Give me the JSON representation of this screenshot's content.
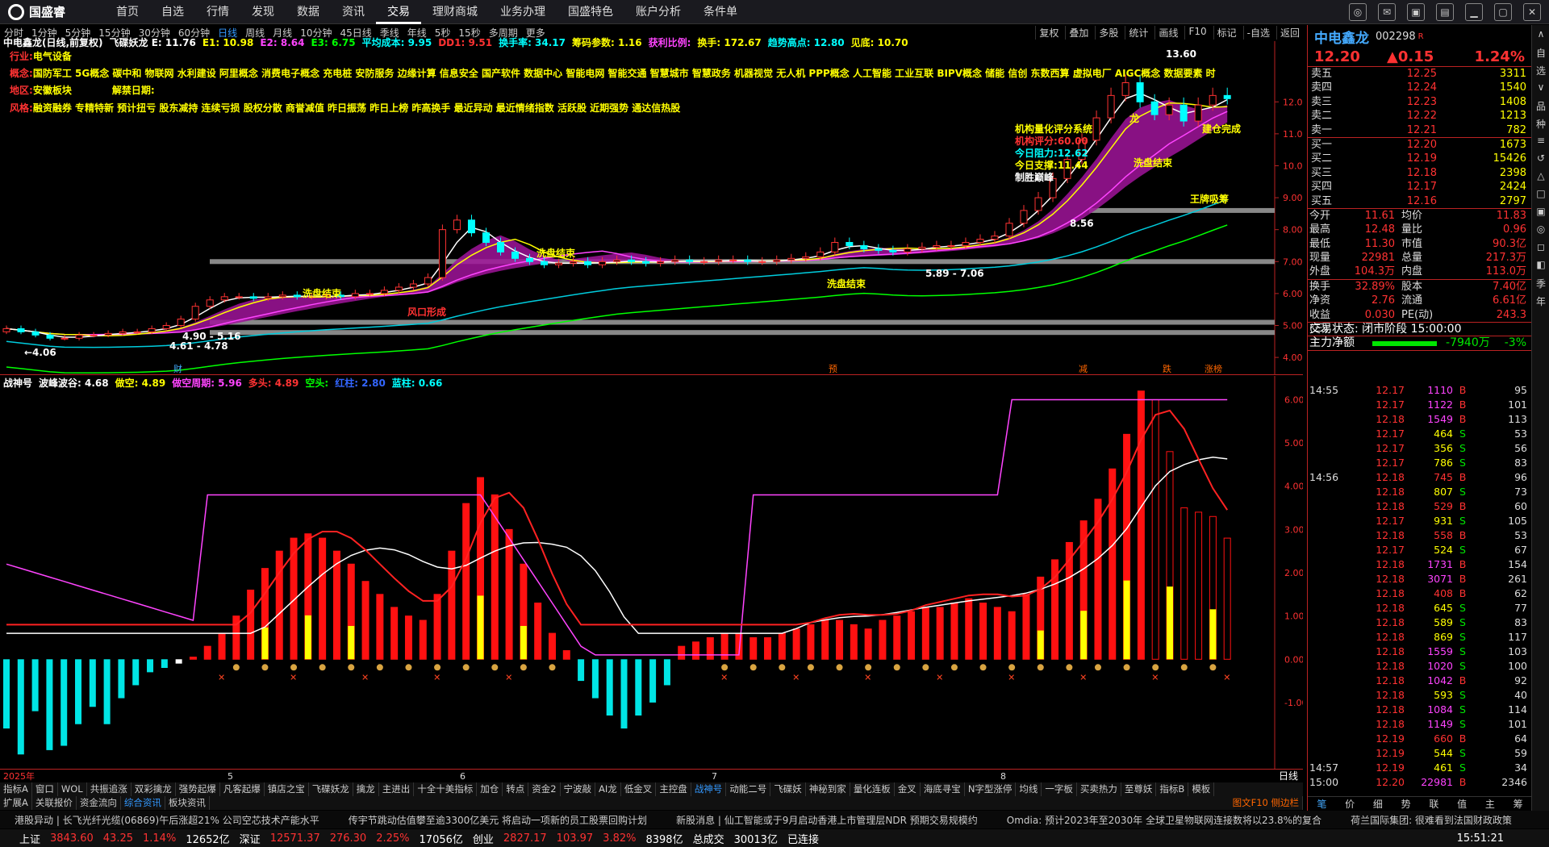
{
  "menu": {
    "logo": "国盛睿",
    "items": [
      "首页",
      "自选",
      "行情",
      "发现",
      "数据",
      "资讯",
      "交易",
      "理财商城",
      "业务办理",
      "国盛特色",
      "账户分析",
      "条件单"
    ],
    "active_index": 6
  },
  "periods": {
    "items": [
      "分时",
      "1分钟",
      "5分钟",
      "15分钟",
      "30分钟",
      "60分钟",
      "日线",
      "周线",
      "月线",
      "10分钟",
      "45日线",
      "季线",
      "年线",
      "5秒",
      "15秒",
      "多周期",
      "更多"
    ],
    "active_index": 6
  },
  "right_tools": [
    "复权",
    "叠加",
    "多股",
    "统计",
    "画线",
    "F10",
    "标记",
    "-自选",
    "返回"
  ],
  "main_header": [
    {
      "text": "中电鑫龙(日线,前复权)",
      "color": "#ffffff"
    },
    {
      "text": "飞碟妖龙 E: 11.76",
      "color": "#ffffff"
    },
    {
      "text": "E1: 10.98",
      "color": "#ffff00"
    },
    {
      "text": "E2: 8.64",
      "color": "#ff44ff"
    },
    {
      "text": "E3: 6.75",
      "color": "#00ff00"
    },
    {
      "text": "平均成本: 9.95",
      "color": "#00ffff"
    },
    {
      "text": "DD1: 9.51",
      "color": "#ff3232"
    },
    {
      "text": "换手率: 34.17",
      "color": "#00ffff"
    },
    {
      "text": "筹码参数: 1.16",
      "color": "#ffff00"
    },
    {
      "text": "获利比例:",
      "color": "#ff44ff"
    },
    {
      "text": "换手: 172.67",
      "color": "#ffff00"
    },
    {
      "text": "趋势高点: 12.80",
      "color": "#00ffff"
    },
    {
      "text": "见底: 10.70",
      "color": "#ffff00"
    }
  ],
  "info": {
    "industry_label": "行业:",
    "industry": "电气设备",
    "concept_label": "概念:",
    "concept": "国防军工 5G概念 碳中和 物联网 水利建设 阿里概念 消费电子概念 充电桩 安防服务 边缘计算 信息安全 国产软件 数据中心 智能电网 智能交通 智慧城市 智慧政务 机器视觉 无人机 PPP概念 人工智能 工业互联 BIPV概念 储能 信创 东数西算 虚拟电厂 AIGC概念 数据要素 时",
    "region_label": "地区:",
    "region": "安徽板块",
    "unlock_label": "解禁日期:",
    "style_label": "风格:",
    "style": "融资融券 专精特新 预计扭亏 股东减持 连续亏损 股权分散 商誉减值 昨日振荡 昨日上榜 昨高换手 最近异动 最近情绪指数 活跃股 近期强势 通达信热股"
  },
  "quant": {
    "title": "机构量化评分系统",
    "score_label": "机构评分:",
    "score": "60.00",
    "resist_label": "今日阻力:",
    "resist": "12.62",
    "support_label": "今日支撑:",
    "support": "11.44",
    "tag": "制胜巅峰"
  },
  "chart_data": [
    {
      "name": "main",
      "type": "candlestick",
      "ylim": [
        3.8,
        13.8
      ],
      "y_ticks": [
        "12.00",
        "11.00",
        "10.00",
        "9.00",
        "8.00",
        "7.00",
        "6.00",
        "5.00",
        "4.00"
      ],
      "annotations": [
        "13.60",
        "8.56",
        "5.89 - 7.06",
        "4.61 - 4.78",
        "4.90 - 5.16",
        "←4.06",
        "洗盘结束",
        "洗盘结束",
        "洗盘结束",
        "洗盘结束",
        "王牌吸筹",
        "建仓完成",
        "风口形成",
        "龙"
      ],
      "bottom_markers": [
        "财",
        "预",
        "减",
        "跌",
        "涨榜"
      ],
      "close_path": [
        4.9,
        4.8,
        4.7,
        4.6,
        4.6,
        4.7,
        4.7,
        4.75,
        4.8,
        4.8,
        4.9,
        5.0,
        5.2,
        5.6,
        5.8,
        5.9,
        5.9,
        5.85,
        5.9,
        5.95,
        5.9,
        5.9,
        5.95,
        5.9,
        6.0,
        6.0,
        6.1,
        6.2,
        6.3,
        6.5,
        8.0,
        8.3,
        7.9,
        7.6,
        7.3,
        7.1,
        7.0,
        6.9,
        6.95,
        7.0,
        6.9,
        7.0,
        7.05,
        7.0,
        6.95,
        7.0,
        7.05,
        7.0,
        7.0,
        7.05,
        7.05,
        7.0,
        7.0,
        7.05,
        7.1,
        7.15,
        7.3,
        7.6,
        7.5,
        7.4,
        7.35,
        7.3,
        7.4,
        7.45,
        7.5,
        7.5,
        7.6,
        7.7,
        7.8,
        8.2,
        8.6,
        9.0,
        9.6,
        10.2,
        10.8,
        11.5,
        12.2,
        12.6,
        12.0,
        11.6,
        11.9,
        11.4,
        11.9,
        12.2,
        12.1
      ]
    },
    {
      "name": "战神号",
      "type": "bar",
      "ylim": [
        -2.4,
        6.4
      ],
      "y_ticks": [
        "6.00",
        "5.00",
        "4.00",
        "3.00",
        "2.00",
        "1.00",
        "0.00",
        "-1.00"
      ],
      "header": [
        {
          "text": "战神号",
          "color": "#ffffff"
        },
        {
          "text": "波峰波谷: 4.68",
          "color": "#ffffff"
        },
        {
          "text": "做空: 4.89",
          "color": "#ffff00"
        },
        {
          "text": "做空周期: 5.96",
          "color": "#ff44ff"
        },
        {
          "text": "多头: 4.89",
          "color": "#ff3232"
        },
        {
          "text": "空头:",
          "color": "#00ff00"
        },
        {
          "text": "红柱: 2.80",
          "color": "#3366ff"
        },
        {
          "text": "蓝柱: 0.66",
          "color": "#00ffff"
        }
      ],
      "values": [
        -1.6,
        -2.2,
        -1.2,
        -2.1,
        -2.0,
        -1.5,
        -1.1,
        -1.5,
        -0.9,
        -0.6,
        -0.3,
        -0.2,
        -0.1,
        0.05,
        0.3,
        0.6,
        1.0,
        1.6,
        2.1,
        2.5,
        2.8,
        2.9,
        2.8,
        2.5,
        2.2,
        1.8,
        1.5,
        1.2,
        1.0,
        0.9,
        1.5,
        2.5,
        3.6,
        4.2,
        3.8,
        3.0,
        2.2,
        1.3,
        0.6,
        0.2,
        -0.5,
        -0.9,
        -1.3,
        -1.6,
        -1.3,
        -1.0,
        -0.6,
        0.3,
        0.4,
        0.5,
        0.6,
        0.6,
        0.5,
        0.5,
        0.6,
        0.7,
        0.8,
        0.9,
        0.9,
        0.8,
        0.7,
        0.9,
        1.0,
        1.1,
        1.2,
        1.2,
        1.3,
        1.4,
        1.3,
        1.2,
        1.1,
        1.5,
        1.9,
        2.3,
        2.7,
        3.2,
        3.7,
        4.4,
        5.2,
        6.2,
        6.0,
        4.8,
        3.5,
        3.4,
        3.3,
        2.8
      ]
    },
    {
      "name": "date_axis",
      "type": "axis",
      "x": [
        "2025年",
        "5",
        "6",
        "7",
        "8"
      ],
      "period_label": "日线"
    }
  ],
  "tabs1": [
    "指标A",
    "窗口",
    "WOL",
    "共振追涨",
    "双彩擒龙",
    "强势起爆",
    "凡客起爆",
    "镇店之宝",
    "飞碟妖龙",
    "擒龙",
    "主进出",
    "十全十美指标",
    "加仓",
    "转点",
    "资金2",
    "宁波敲",
    "AI龙",
    "低金叉",
    "主控盘",
    "战神号",
    "动能二号",
    "飞碟妖",
    "神秘到家",
    "量化连板",
    "金叉",
    "海底寻宝",
    "N字型涨停",
    "均线",
    "一字板",
    "买卖热力",
    "至尊妖",
    "指标B",
    "模板"
  ],
  "tabs1_active": 19,
  "tabs2": [
    "扩展A",
    "关联报价",
    "资金流向",
    "综合资讯",
    "板块资讯"
  ],
  "tabs2_right": "图文F10 侧边栏",
  "news": [
    "港股异动 | 长飞光纤光缆(06869)午后涨超21% 公司空芯技术产能水平",
    "传宇节跳动估值攀至逾3300亿美元 将启动一项新的员工股票回购计划",
    "新股消息 | 仙工智能或于9月启动香港上市管理层NDR 预期交易规模约",
    "Omdia: 预计2023年至2030年 全球卫星物联网连接数将以23.8%的复合",
    "荷兰国际集团: 很难看到法国财政政策"
  ],
  "status": {
    "sh_label": "上证",
    "sh": "3843.60",
    "sh_chg": "43.25",
    "sh_pct": "1.14%",
    "sh_amt": "12652亿",
    "sz_label": "深证",
    "sz": "12571.37",
    "sz_chg": "276.30",
    "sz_pct": "2.25%",
    "sz_amt": "17056亿",
    "cy_label": "创业",
    "cy": "2827.17",
    "cy_chg": "103.97",
    "cy_pct": "3.82%",
    "cy_amt": "8398亿",
    "total_label": "总成交",
    "total": "30013亿",
    "conn": "已连接",
    "time": "15:51:21"
  },
  "quote": {
    "name": "中电鑫龙",
    "code": "002298",
    "flag": "R",
    "price": "12.20",
    "chg": "▲0.15",
    "pct": "1.24%",
    "asks": [
      [
        "卖五",
        "12.25",
        "3311"
      ],
      [
        "卖四",
        "12.24",
        "1540"
      ],
      [
        "卖三",
        "12.23",
        "1408"
      ],
      [
        "卖二",
        "12.22",
        "1213"
      ],
      [
        "卖一",
        "12.21",
        "782"
      ]
    ],
    "bids": [
      [
        "买一",
        "12.20",
        "1673"
      ],
      [
        "买二",
        "12.19",
        "15426"
      ],
      [
        "买三",
        "12.18",
        "2398"
      ],
      [
        "买四",
        "12.17",
        "2424"
      ],
      [
        "买五",
        "12.16",
        "2797"
      ]
    ],
    "stats": [
      [
        "今开",
        "11.61",
        "均价",
        "11.83"
      ],
      [
        "最高",
        "12.48",
        "量比",
        "0.96"
      ],
      [
        "最低",
        "11.30",
        "市值",
        "90.3亿"
      ],
      [
        "现量",
        "22981",
        "总量",
        "217.3万"
      ],
      [
        "外盘",
        "104.3万",
        "内盘",
        "113.0万"
      ]
    ],
    "stats2": [
      [
        "换手",
        "32.89%",
        "股本",
        "7.40亿"
      ],
      [
        "净资",
        "2.76",
        "流通",
        "6.61亿"
      ],
      [
        "收益(三)",
        "0.030",
        "PE(动)",
        "243.3"
      ]
    ],
    "trade_status": "交易状态: 闭市阶段 15:00:00",
    "flow_label": "主力净额",
    "flow": "-7940万",
    "flow_pct": "-3%",
    "ticks": [
      [
        "14:55",
        "12.17",
        "1110",
        "B",
        "95"
      ],
      [
        "",
        "12.17",
        "1122",
        "B",
        "101"
      ],
      [
        "",
        "12.18",
        "1549",
        "B",
        "113"
      ],
      [
        "",
        "12.17",
        "464",
        "S",
        "53"
      ],
      [
        "",
        "12.17",
        "356",
        "S",
        "56"
      ],
      [
        "",
        "12.17",
        "786",
        "S",
        "83"
      ],
      [
        "14:56",
        "12.18",
        "745",
        "B",
        "96"
      ],
      [
        "",
        "12.18",
        "807",
        "S",
        "73"
      ],
      [
        "",
        "12.18",
        "529",
        "B",
        "60"
      ],
      [
        "",
        "12.17",
        "931",
        "S",
        "105"
      ],
      [
        "",
        "12.18",
        "558",
        "B",
        "53"
      ],
      [
        "",
        "12.17",
        "524",
        "S",
        "67"
      ],
      [
        "",
        "12.18",
        "1731",
        "B",
        "154"
      ],
      [
        "",
        "12.18",
        "3071",
        "B",
        "261"
      ],
      [
        "",
        "12.18",
        "408",
        "B",
        "62"
      ],
      [
        "",
        "12.18",
        "645",
        "S",
        "77"
      ],
      [
        "",
        "12.18",
        "589",
        "S",
        "83"
      ],
      [
        "",
        "12.18",
        "869",
        "S",
        "117"
      ],
      [
        "",
        "12.18",
        "1559",
        "S",
        "103"
      ],
      [
        "",
        "12.18",
        "1020",
        "S",
        "100"
      ],
      [
        "",
        "12.18",
        "1042",
        "B",
        "92"
      ],
      [
        "",
        "12.18",
        "593",
        "S",
        "40"
      ],
      [
        "",
        "12.18",
        "1084",
        "S",
        "114"
      ],
      [
        "",
        "12.18",
        "1149",
        "S",
        "101"
      ],
      [
        "",
        "12.19",
        "660",
        "B",
        "64"
      ],
      [
        "",
        "12.19",
        "544",
        "S",
        "59"
      ],
      [
        "14:57",
        "12.19",
        "461",
        "S",
        "34"
      ],
      [
        "15:00",
        "12.20",
        "22981",
        "B",
        "2346"
      ]
    ],
    "bottom_tabs": [
      "笔",
      "价",
      "细",
      "势",
      "联",
      "值",
      "主",
      "筹"
    ]
  },
  "side_buttons": [
    "∧",
    "自",
    "选",
    "∨",
    "品",
    "种",
    "≡",
    "↺",
    "△",
    "□",
    "▣",
    "◎",
    "◻",
    "◧",
    "季",
    "年"
  ]
}
